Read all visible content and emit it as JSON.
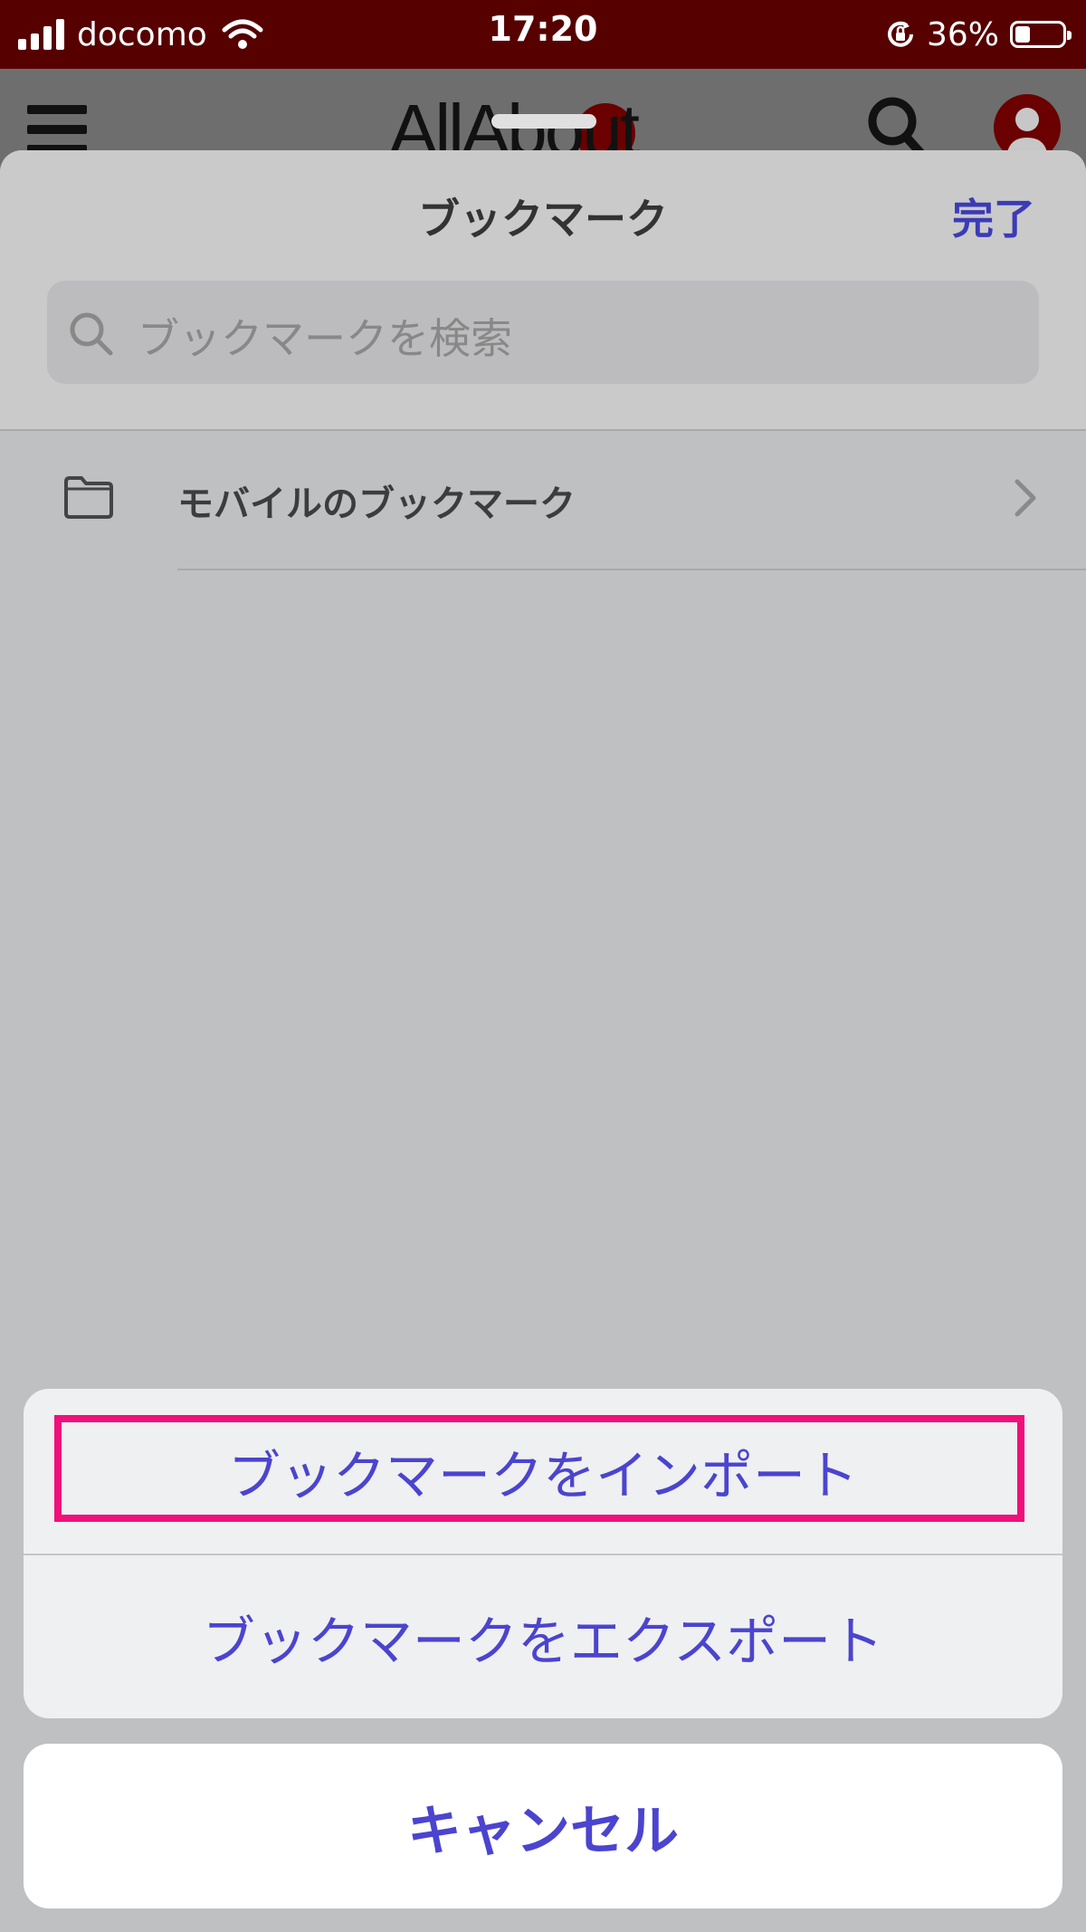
{
  "status_bar": {
    "carrier": "docomo",
    "time": "17:20",
    "battery_percent": "36%",
    "battery_level": 0.36
  },
  "background_app": {
    "logo_text": "AllAbout"
  },
  "bookmarks_sheet": {
    "title": "ブックマーク",
    "done_label": "完了",
    "search_placeholder": "ブックマークを検索",
    "folders": [
      {
        "label": "モバイルのブックマーク"
      }
    ]
  },
  "action_sheet": {
    "import_label": "ブックマークをインポート",
    "export_label": "ブックマークをエクスポート",
    "cancel_label": "キャンセル"
  },
  "colors": {
    "status_bar_bg": "#560000",
    "accent": "#4b44cf",
    "highlight": "#f0107a"
  }
}
